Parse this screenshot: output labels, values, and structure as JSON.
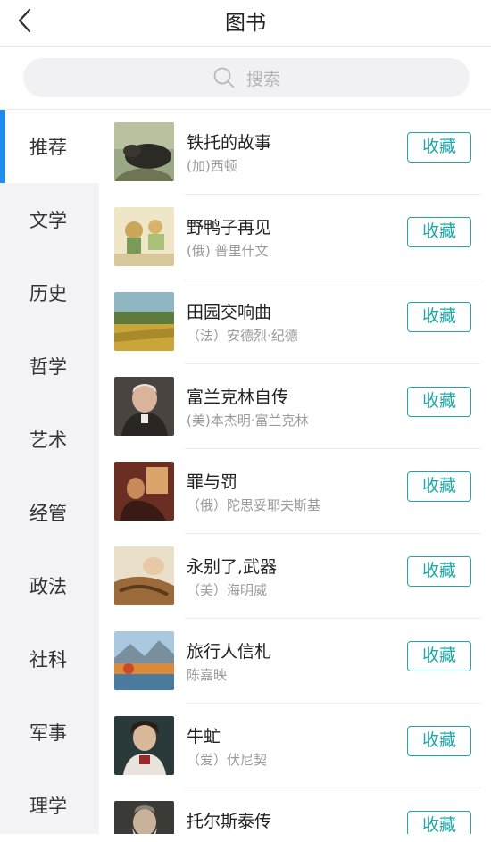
{
  "header": {
    "title": "图书",
    "back_icon": "chevron-left-icon"
  },
  "search": {
    "placeholder": "搜索",
    "icon": "search-icon"
  },
  "sidebar": {
    "active_color": "#1e8df0",
    "items": [
      {
        "label": "推荐",
        "active": true
      },
      {
        "label": "文学"
      },
      {
        "label": "历史"
      },
      {
        "label": "哲学"
      },
      {
        "label": "艺术"
      },
      {
        "label": "经管"
      },
      {
        "label": "政法"
      },
      {
        "label": "社科"
      },
      {
        "label": "军事"
      },
      {
        "label": "理学"
      }
    ]
  },
  "books": [
    {
      "title": "铁托的故事",
      "author": "(加)西顿",
      "action": "收藏"
    },
    {
      "title": "野鸭子再见",
      "author": "(俄) 普里什文",
      "action": "收藏"
    },
    {
      "title": "田园交响曲",
      "author": "（法）安德烈·纪德",
      "action": "收藏"
    },
    {
      "title": "富兰克林自传",
      "author": "(美)本杰明·富兰克林",
      "action": "收藏"
    },
    {
      "title": "罪与罚",
      "author": "（俄）陀思妥耶夫斯基",
      "action": "收藏"
    },
    {
      "title": "永别了,武器",
      "author": "（美）海明威",
      "action": "收藏"
    },
    {
      "title": "旅行人信札",
      "author": "陈嘉映",
      "action": "收藏"
    },
    {
      "title": "牛虻",
      "author": "（爱）伏尼契",
      "action": "收藏"
    },
    {
      "title": "托尔斯泰传",
      "author": "",
      "action": "收藏"
    }
  ],
  "colors": {
    "accent": "#1fa7a8",
    "sidebar_bg": "#f3f3f5"
  }
}
